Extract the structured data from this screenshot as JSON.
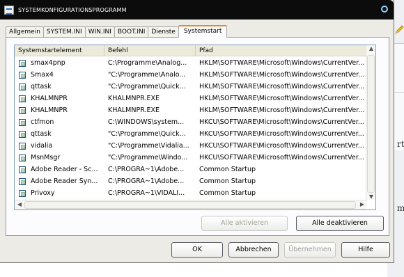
{
  "window": {
    "title": "SYSTEMKONFIGURATIONSPROGRAMM"
  },
  "tabs": [
    {
      "label": "Allgemein"
    },
    {
      "label": "SYSTEM.INI"
    },
    {
      "label": "WIN.INI"
    },
    {
      "label": "BOOT.INI"
    },
    {
      "label": "Dienste"
    },
    {
      "label": "Systemstart",
      "active": true
    }
  ],
  "table": {
    "columns": [
      "Systemstartelement",
      "Befehl",
      "Pfad"
    ],
    "rows": [
      {
        "name": "smax4pnp",
        "command": "C:\\Programme\\Analog...",
        "path": "HKLM\\SOFTWARE\\Microsoft\\Windows\\CurrentVer..."
      },
      {
        "name": "Smax4",
        "command": "\"C:\\Programme\\Analo...",
        "path": "HKLM\\SOFTWARE\\Microsoft\\Windows\\CurrentVer..."
      },
      {
        "name": "qttask",
        "command": "\"C:\\Programme\\Quick...",
        "path": "HKLM\\SOFTWARE\\Microsoft\\Windows\\CurrentVer..."
      },
      {
        "name": "KHALMNPR",
        "command": "KHALMNPR.EXE",
        "path": "HKLM\\SOFTWARE\\Microsoft\\Windows\\CurrentVer..."
      },
      {
        "name": "KHALMNPR",
        "command": "KHALMNPR.EXE",
        "path": "HKLM\\SOFTWARE\\Microsoft\\Windows\\CurrentVer..."
      },
      {
        "name": "ctfmon",
        "command": "C:\\WINDOWS\\system...",
        "path": "HKCU\\SOFTWARE\\Microsoft\\Windows\\CurrentVer..."
      },
      {
        "name": "qttask",
        "command": "\"C:\\Programme\\Quick...",
        "path": "HKCU\\SOFTWARE\\Microsoft\\Windows\\CurrentVer..."
      },
      {
        "name": "vidalia",
        "command": "\"C:\\Programme\\Vidalia...",
        "path": "HKCU\\SOFTWARE\\Microsoft\\Windows\\CurrentVer..."
      },
      {
        "name": "MsnMsgr",
        "command": "\"C:\\Programme\\Windo...",
        "path": "HKCU\\SOFTWARE\\Microsoft\\Windows\\CurrentVer..."
      },
      {
        "name": "Adobe Reader - Sc...",
        "command": "C:\\PROGRA~1\\Adobe...",
        "path": "Common Startup"
      },
      {
        "name": "Adobe Reader Syn...",
        "command": "C:\\PROGRA~1\\Adobe...",
        "path": "Common Startup"
      },
      {
        "name": "Privoxy",
        "command": "C:\\PROGRA~1\\VIDALI...",
        "path": "Common Startup"
      }
    ]
  },
  "buttons": {
    "enable_all": "Alle aktivieren",
    "disable_all": "Alle deaktivieren",
    "ok": "OK",
    "cancel": "Abbrechen",
    "apply": "Übernehmen",
    "help": "Hilfe"
  },
  "background": {
    "fragments": [
      "rt",
      "m"
    ]
  }
}
